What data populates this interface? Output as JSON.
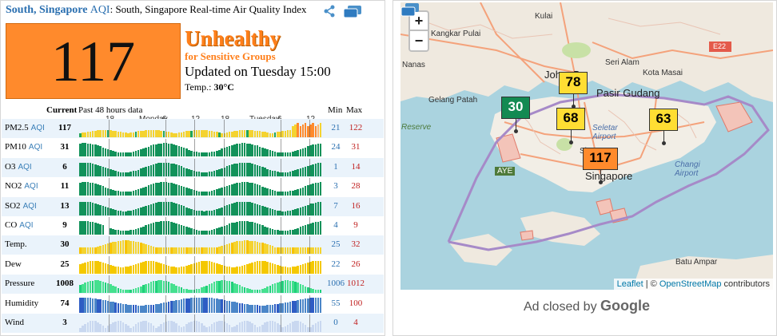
{
  "header": {
    "city": "South, Singapore",
    "aqi_word": "AQI",
    "title_rest": ": South, Singapore Real-time Air Quality Index",
    "share_icon": "share-icon",
    "window_icon": "window-icon"
  },
  "aqi": {
    "value": "117",
    "color": "#ff8a2c",
    "status_line1": "Unhealthy",
    "status_line2": "for Sensitive Groups",
    "updated": "Updated on Tuesday 15:00",
    "temp_label": "Temp.:",
    "temp_value": "30°C"
  },
  "table": {
    "current_label": "Current",
    "past_label": "Past 48 hours data",
    "min_label": "Min",
    "max_label": "Max",
    "axis_top": [
      "18",
      "Monday",
      "6",
      "12",
      "18",
      "Tuesday",
      "6",
      "12"
    ],
    "axis_mid": [
      "18",
      "Monday",
      "6",
      "12",
      "18",
      "Tuesday",
      "6",
      "12"
    ],
    "rows": [
      {
        "label": "PM2.5",
        "sub": "AQI",
        "current": "117",
        "min": "21",
        "max": "122",
        "shade": true,
        "kind": "pm25"
      },
      {
        "label": "PM10",
        "sub": "AQI",
        "current": "31",
        "min": "24",
        "max": "31",
        "shade": false,
        "kind": "green"
      },
      {
        "label": "O3",
        "sub": "AQI",
        "current": "6",
        "min": "1",
        "max": "14",
        "shade": true,
        "kind": "green"
      },
      {
        "label": "NO2",
        "sub": "AQI",
        "current": "11",
        "min": "3",
        "max": "28",
        "shade": false,
        "kind": "green"
      },
      {
        "label": "SO2",
        "sub": "AQI",
        "current": "13",
        "min": "7",
        "max": "16",
        "shade": true,
        "kind": "green"
      },
      {
        "label": "CO",
        "sub": "AQI",
        "current": "9",
        "min": "4",
        "max": "9",
        "shade": false,
        "kind": "green"
      },
      {
        "label": "Temp.",
        "sub": "",
        "current": "30",
        "min": "25",
        "max": "32",
        "shade": true,
        "kind": "temp"
      },
      {
        "label": "Dew",
        "sub": "",
        "current": "25",
        "min": "22",
        "max": "26",
        "shade": false,
        "kind": "dew"
      },
      {
        "label": "Pressure",
        "sub": "",
        "current": "1008",
        "min": "1006",
        "max": "1012",
        "shade": true,
        "kind": "pressure"
      },
      {
        "label": "Humidity",
        "sub": "",
        "current": "74",
        "min": "55",
        "max": "100",
        "shade": false,
        "kind": "humidity"
      },
      {
        "label": "Wind",
        "sub": "",
        "current": "3",
        "min": "0",
        "max": "4",
        "shade": true,
        "kind": "wind"
      }
    ]
  },
  "map": {
    "zoom_in": "+",
    "zoom_out": "−",
    "window_icon": "window-icon",
    "labels": {
      "kangkar_pulai": "Kangkar Pulai",
      "kulai": "Kulai",
      "johor_bahru": "Johor Ba",
      "seri_alam": "Seri Alam",
      "kota_masai": "Kota Masai",
      "pasir_gudang": "Pasir Gudang",
      "nanas": "Nanas",
      "gelang_patah": "Gelang Patah",
      "reserve": "Reserve",
      "aye": "AYE",
      "singapore": "Singapore",
      "seletar": "Seletar\nAirport",
      "changi": "Changi\nAirport",
      "e22": "E22",
      "batu_ampar": "Batu Ampar",
      "sin": "Sin"
    },
    "markers": [
      {
        "value": "30",
        "color": "#138a52",
        "text_color": "#ffffff"
      },
      {
        "value": "78",
        "color": "#ffde33",
        "text_color": "#000000"
      },
      {
        "value": "68",
        "color": "#ffde33",
        "text_color": "#000000"
      },
      {
        "value": "63",
        "color": "#ffde33",
        "text_color": "#000000"
      },
      {
        "value": "117",
        "color": "#ff8a2c",
        "text_color": "#000000"
      }
    ],
    "attribution_leaflet": "Leaflet",
    "attribution_sep": " | © ",
    "attribution_osm": "OpenStreetMap",
    "attribution_rest": " contributors"
  },
  "ad": {
    "text": "Ad closed by",
    "brand": "Google"
  }
}
